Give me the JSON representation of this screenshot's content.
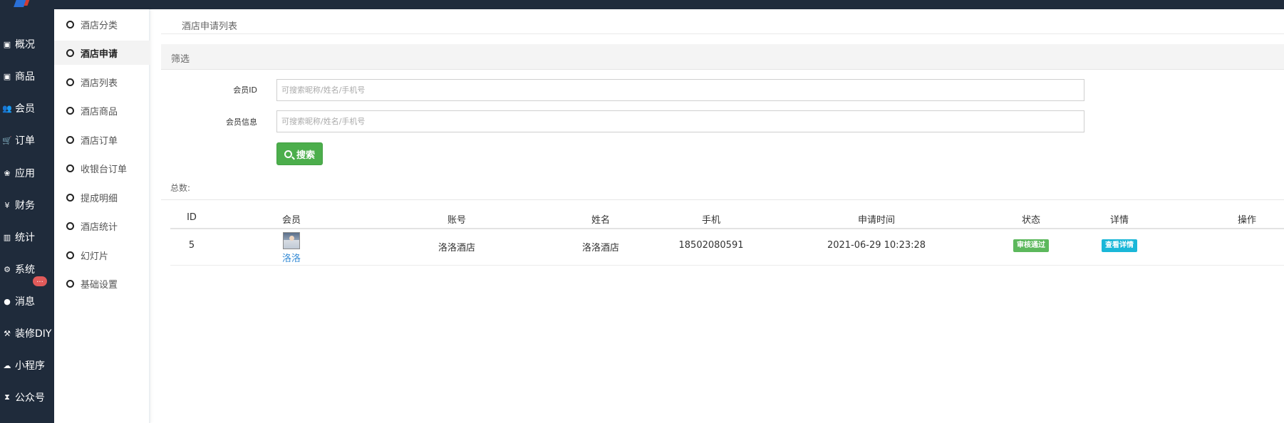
{
  "nav": [
    {
      "icon": "archive-icon",
      "glyph": "▣",
      "label": "概况"
    },
    {
      "icon": "box-icon",
      "glyph": "▣",
      "label": "商品"
    },
    {
      "icon": "users-icon",
      "glyph": "👥",
      "label": "会员"
    },
    {
      "icon": "cart-icon",
      "glyph": "🛒",
      "label": "订单"
    },
    {
      "icon": "apps-icon",
      "glyph": "❀",
      "label": "应用"
    },
    {
      "icon": "yen-icon",
      "glyph": "¥",
      "label": "财务"
    },
    {
      "icon": "bar-chart-icon",
      "glyph": "▥",
      "label": "统计"
    },
    {
      "icon": "cogs-icon",
      "glyph": "⚙",
      "label": "系统"
    },
    {
      "icon": "chat-icon",
      "glyph": "●",
      "label": "消息"
    },
    {
      "icon": "hammer-icon",
      "glyph": "⚒",
      "label": "装修DIY"
    },
    {
      "icon": "wechat-icon",
      "glyph": "☁",
      "label": "小程序"
    },
    {
      "icon": "hourglass-icon",
      "glyph": "⧗",
      "label": "公众号"
    }
  ],
  "message_badge": "...",
  "submenu": [
    {
      "label": "酒店分类",
      "active": false
    },
    {
      "label": "酒店申请",
      "active": true
    },
    {
      "label": "酒店列表",
      "active": false
    },
    {
      "label": "酒店商品",
      "active": false
    },
    {
      "label": "酒店订单",
      "active": false
    },
    {
      "label": "收银台订单",
      "active": false
    },
    {
      "label": "提成明细",
      "active": false
    },
    {
      "label": "酒店统计",
      "active": false
    },
    {
      "label": "幻灯片",
      "active": false
    },
    {
      "label": "基础设置",
      "active": false
    }
  ],
  "breadcrumb": "酒店申请列表",
  "filter": {
    "title": "筛选",
    "member_id_label": "会员ID",
    "member_id_placeholder": "可搜索昵称/姓名/手机号",
    "member_info_label": "会员信息",
    "member_info_placeholder": "可搜索昵称/姓名/手机号",
    "search_button": "搜索"
  },
  "total_label": "总数:",
  "table": {
    "headers": [
      "ID",
      "会员",
      "账号",
      "姓名",
      "手机",
      "申请时间",
      "状态",
      "详情",
      "操作"
    ],
    "rows": [
      {
        "id": "5",
        "member": "洛洛",
        "account": "洛洛酒店",
        "name": "洛洛酒店",
        "phone": "18502080591",
        "apply_time": "2021-06-29 10:23:28",
        "status": "审核通过",
        "detail": "查看详情"
      }
    ]
  }
}
